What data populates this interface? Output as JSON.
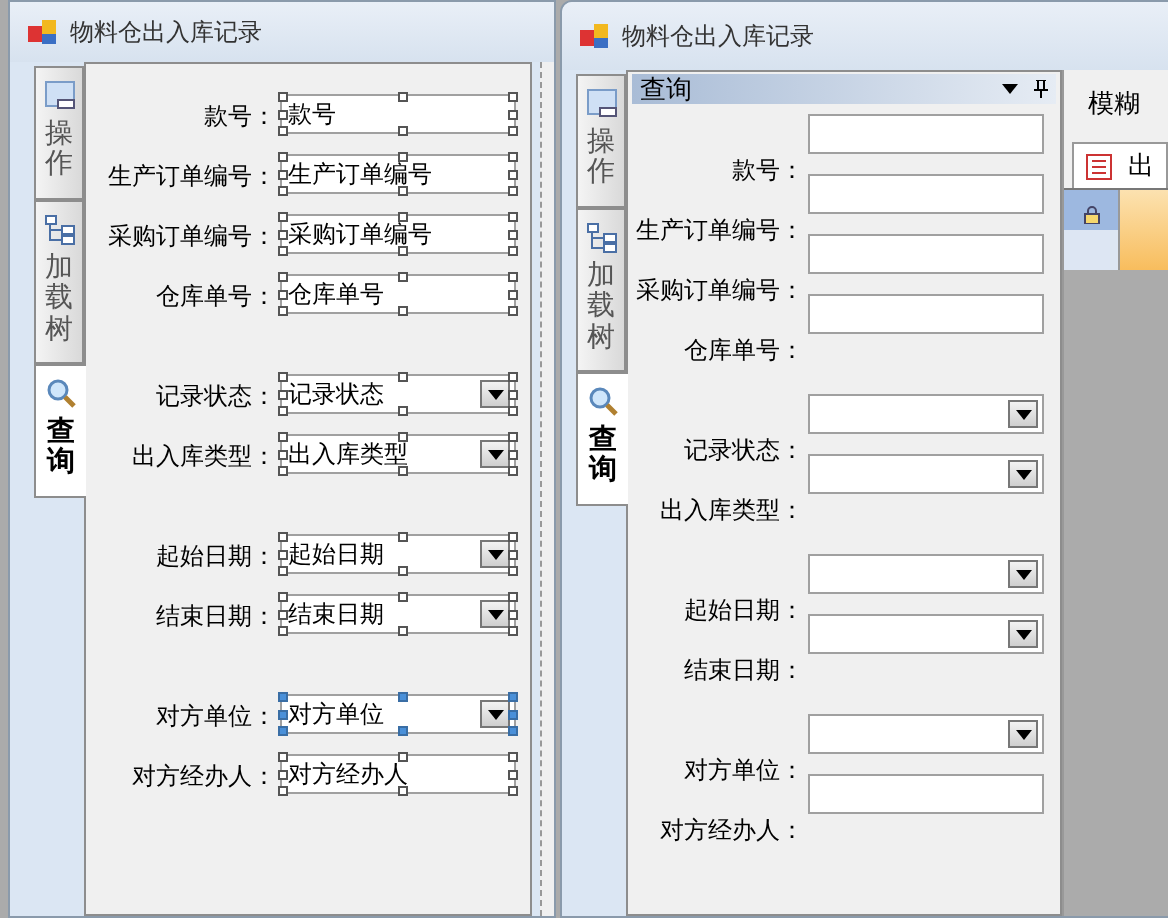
{
  "designer_window": {
    "title": "物料仓出入库记录",
    "side_tabs": [
      {
        "label": "操作",
        "selected": false
      },
      {
        "label": "加载树",
        "selected": false
      },
      {
        "label": "查询",
        "selected": true
      }
    ],
    "groups": [
      [
        {
          "label": "款号：",
          "value": "款号",
          "kind": "textbox",
          "selected": false
        },
        {
          "label": "生产订单编号：",
          "value": "生产订单编号",
          "kind": "textbox",
          "selected": false
        },
        {
          "label": "采购订单编号：",
          "value": "采购订单编号",
          "kind": "textbox",
          "selected": false
        },
        {
          "label": "仓库单号：",
          "value": "仓库单号",
          "kind": "textbox",
          "selected": false
        }
      ],
      [
        {
          "label": "记录状态：",
          "value": "记录状态",
          "kind": "combo",
          "selected": false
        },
        {
          "label": "出入库类型：",
          "value": "出入库类型",
          "kind": "combo",
          "selected": false
        }
      ],
      [
        {
          "label": "起始日期：",
          "value": "起始日期",
          "kind": "combo",
          "selected": false
        },
        {
          "label": "结束日期：",
          "value": "结束日期",
          "kind": "combo",
          "selected": false
        }
      ],
      [
        {
          "label": "对方单位：",
          "value": "对方单位",
          "kind": "combo",
          "selected": true
        },
        {
          "label": "对方经办人：",
          "value": "对方经办人",
          "kind": "textbox",
          "selected": false
        }
      ]
    ]
  },
  "runtime_window": {
    "title": "物料仓出入库记录",
    "side_tabs": [
      {
        "label": "操作",
        "selected": false
      },
      {
        "label": "加载树",
        "selected": false
      },
      {
        "label": "查询",
        "selected": true
      }
    ],
    "panel_title": "查询",
    "groups": [
      [
        {
          "label": "款号：",
          "kind": "textbox"
        },
        {
          "label": "生产订单编号：",
          "kind": "textbox"
        },
        {
          "label": "采购订单编号：",
          "kind": "textbox"
        },
        {
          "label": "仓库单号：",
          "kind": "textbox"
        }
      ],
      [
        {
          "label": "记录状态：",
          "kind": "combo"
        },
        {
          "label": "出入库类型：",
          "kind": "combo"
        }
      ],
      [
        {
          "label": "起始日期：",
          "kind": "combo"
        },
        {
          "label": "结束日期：",
          "kind": "combo"
        }
      ],
      [
        {
          "label": "对方单位：",
          "kind": "combo"
        },
        {
          "label": "对方经办人：",
          "kind": "textbox"
        }
      ]
    ],
    "search_label": "模糊",
    "result_tab": "出"
  }
}
